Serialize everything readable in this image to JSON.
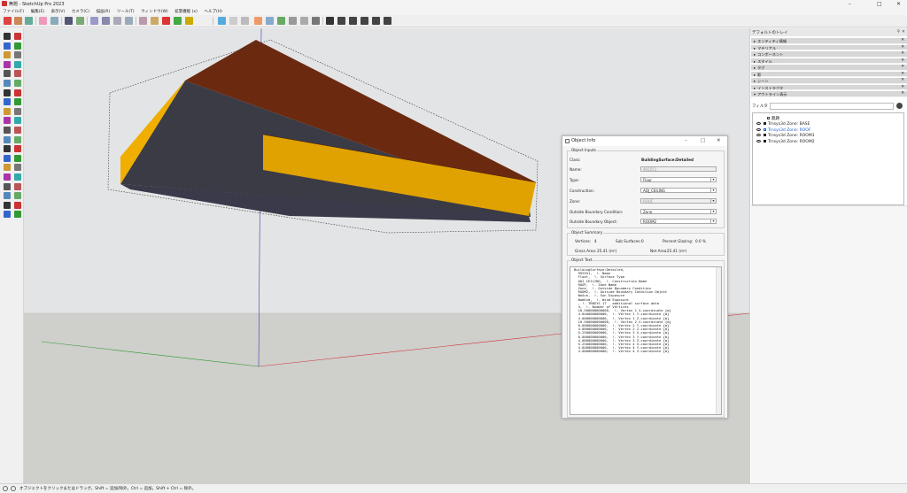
{
  "window": {
    "title": "無題 - SketchUp Pro 2023",
    "min": "–",
    "max": "□",
    "close": "✕"
  },
  "menu": [
    "ファイル(F)",
    "編集(E)",
    "表示(V)",
    "カメラ(C)",
    "描画(R)",
    "ツール(T)",
    "ウィンドウ(W)",
    "拡張機能 (x)",
    "ヘルプ(H)"
  ],
  "tray": {
    "title": "デフォルトのトレイ",
    "panels": [
      "エンティティ情報",
      "マテリアル",
      "コンポーネント",
      "スタイル",
      "タグ",
      "影",
      "シーン",
      "インストラクタ",
      "アウトライン表示"
    ],
    "filter_label": "フィルタ",
    "outliner": {
      "root": "無題",
      "items": [
        {
          "label": "Trnsys3d Zone: BASE",
          "selected": false
        },
        {
          "label": "Trnsys3d Zone: ROOF",
          "selected": true
        },
        {
          "label": "Trnsys3d Zone: ROOM1",
          "selected": false
        },
        {
          "label": "Trnsys3d Zone: ROOM2",
          "selected": false
        }
      ]
    }
  },
  "dialog": {
    "title": "Object Info",
    "inputs_label": "Object Inputs",
    "class_label": "Class:",
    "class_value": "BuildingSurface:Detailed",
    "name_label": "Name:",
    "name_value": "992551",
    "type_label": "Type:",
    "type_value": "Floor",
    "construction_label": "Construction:",
    "construction_value": "ADJ_CEILING",
    "zone_label": "Zone:",
    "zone_value": "ROOF",
    "obc_label": "Outside Boundary Condition:",
    "obc_value": "Zone",
    "obo_label": "Outside Boundary Object:",
    "obo_value": "ROOM2",
    "summary_label": "Object Summary",
    "vertices_label": "Vertices:",
    "vertices_value": "4",
    "subsurf_label": "Sub Surfaces:",
    "subsurf_value": "0",
    "glazing_label": "Percent Glazing:",
    "glazing_value": "0.0 %",
    "gross_label": "Gross Area:",
    "gross_value": "25.41 (m²)",
    "net_label": "Net Area:",
    "net_value": "25.41 (m²)",
    "text_label": "Object Text",
    "text": "BuildingSurface:Detailed,\n  992551,  !- Name\n  Floor,  !- Surface Type\n  ADJ_CEILING,  !- Construction Name\n  ROOF,  !- Zone Name\n  Zone,  !- Outside Boundary Condition\n  ROOM2,  !- Outside Boundary Condition Object\n  NoSun,  !- Sun Exposure\n  NoWind,  !- Wind Exposure\n  , !- TRNSYS 17 - additional surface data\n  4,  !- Number of Vertices\n  10.500000000000,  !- Vertex 1 X-coordinate {m}\n  4.840000000000,  !- Vertex 1 Y-coordinate {m}\n  4.000000000000,  !- Vertex 1 Z-coordinate {m}\n  10.500000000000,  !- Vertex 2 X-coordinate {m}\n  0.000000000000,  !- Vertex 2 Y-coordinate {m}\n  4.000000000000,  !- Vertex 2 Z-coordinate {m}\n  5.250000000000,  !- Vertex 3 X-coordinate {m}\n  0.000000000000,  !- Vertex 3 Y-coordinate {m}\n  4.000000000000,  !- Vertex 3 Z-coordinate {m}\n  5.250000000000,  !- Vertex 4 X-coordinate {m}\n  4.840000000000,  !- Vertex 4 Y-coordinate {m}\n  4.000000000000;  !- Vertex 4 Z-coordinate {m}"
  },
  "status": {
    "text": "オブジェクトをクリックまたはドラッグ。Shift = 追加/除外。Ctrl = 追加。Shift + Ctrl = 除外。"
  },
  "colors": {
    "roof_dark": "#6b2a10",
    "facade_yellow": "#f0ae00",
    "floor_dark": "#3b3b46",
    "accent_blue": "#1e5fd0"
  },
  "icons": [
    "select-icon",
    "eraser-icon",
    "pencil-icon",
    "rectangle-icon",
    "circle-icon",
    "arc-icon",
    "move-icon",
    "rotate-icon",
    "scale-icon",
    "push-pull-icon",
    "offset-icon",
    "tape-measure-icon",
    "text-icon",
    "axes-icon",
    "section-plane-icon",
    "orbit-icon",
    "pan-icon",
    "zoom-icon",
    "zoom-extents-icon",
    "walk-icon",
    "look-around-icon",
    "position-camera-icon",
    "play-icon",
    "prev-icon",
    "next-icon"
  ]
}
